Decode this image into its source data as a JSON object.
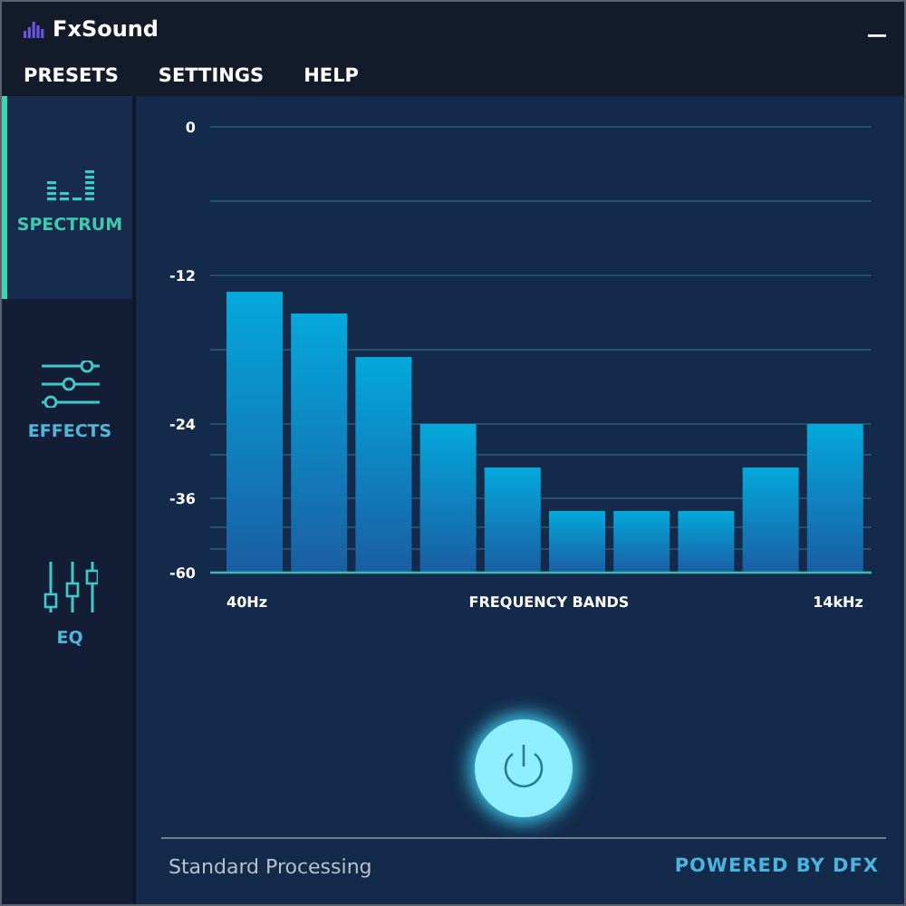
{
  "window": {
    "title": "FxSound"
  },
  "menu": [
    {
      "label": "PRESETS"
    },
    {
      "label": "SETTINGS"
    },
    {
      "label": "HELP"
    }
  ],
  "sidebar": {
    "items": [
      {
        "kind": "spectrum",
        "label": "SPECTRUM",
        "selected": true
      },
      {
        "kind": "effects",
        "label": "EFFECTS",
        "selected": false
      },
      {
        "kind": "eq",
        "label": "EQ",
        "selected": false
      }
    ]
  },
  "spectrum": {
    "scale_labels": [
      "0",
      "-12",
      "-24",
      "-36",
      "-60"
    ],
    "band_start": "40Hz",
    "band_label": "FREQUENCY BANDS",
    "band_end": "14kHz"
  },
  "power": {
    "on": true
  },
  "status": {
    "mode": "Standard Processing",
    "brand": "POWERED BY DFX"
  }
}
